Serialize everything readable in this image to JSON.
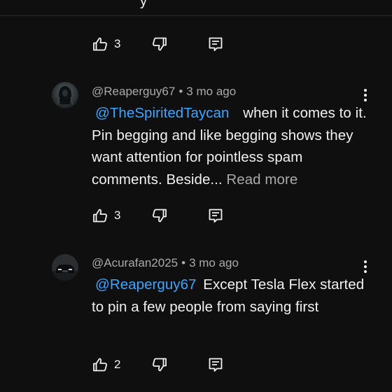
{
  "top_comment_tail": {
    "cut_text": "y",
    "like_count": "3"
  },
  "comments": [
    {
      "author": "@Reaperguy67",
      "separator": "•",
      "time": "3 mo ago",
      "mention": "@TheSpiritedTaycan",
      "text": " when it comes to it. Pin begging and like begging shows they want attention for pointless spam comments.  Beside...",
      "read_more": "Read more",
      "like_count": "3",
      "avatar": "dark-hooded-figure-avatar"
    },
    {
      "author": "@Acurafan2025",
      "separator": "•",
      "time": "3 mo ago",
      "mention": "@Reaperguy67",
      "text": " Except Tesla Flex started to pin a few people from saying first",
      "like_count": "2",
      "avatar": "dark-car-avatar"
    }
  ],
  "icons": {
    "like": "thumbs-up-icon",
    "dislike": "thumbs-down-icon",
    "reply": "reply-icon",
    "menu": "more-vert-icon"
  },
  "colors": {
    "background": "#0f0f0f",
    "text": "#f1f1f1",
    "secondary_text": "#aaaaaa",
    "mention": "#3ea6ff"
  }
}
